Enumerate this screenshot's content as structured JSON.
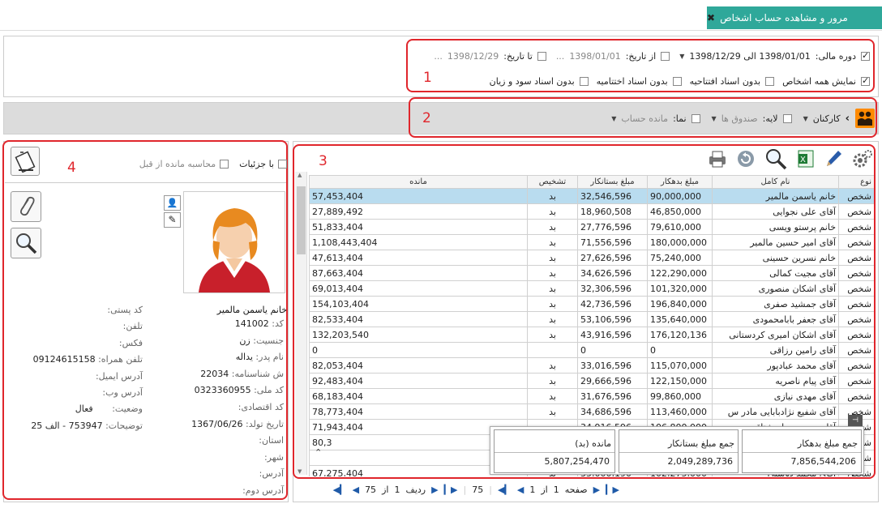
{
  "title_bar": {
    "title": "مرور و مشاهده حساب اشخاص",
    "close_icon": "✖"
  },
  "filters": {
    "fiscal_period_label": "دوره مالی:",
    "fiscal_period_value": "1398/01/01 الی 1398/12/29",
    "from_date_label": "از تاریخ:",
    "from_date_value": "1398/01/01",
    "to_date_label": "تا تاریخ:",
    "to_date_value": "1398/12/29",
    "ellipsis": "...",
    "show_all_persons": "نمایش همه اشخاص",
    "no_opening_docs": "بدون اسناد افتتاحیه",
    "no_closing_docs": "بدون اسناد اختتامیه",
    "no_profit_loss_docs": "بدون اسناد سود و زیان"
  },
  "toolbar": {
    "group_value": "کارکنان",
    "layer_label": "لایه:",
    "layer_value": "صندوق ها",
    "view_label": "نما:",
    "view_value": "مانده حساب"
  },
  "grid": {
    "headers": [
      "نوع",
      "نام کامل",
      "مبلغ بدهکار",
      "مبلغ بستانکار",
      "تشخیص",
      "مانده"
    ],
    "rows": [
      [
        "شخص",
        "خانم یاسمن مالمیر",
        "90,000,000",
        "32,546,596",
        "بد",
        "57,453,404"
      ],
      [
        "شخص",
        "آقای علی نجوایی",
        "46,850,000",
        "18,960,508",
        "بد",
        "27,889,492"
      ],
      [
        "شخص",
        "خانم پرستو ویسی",
        "79,610,000",
        "27,776,596",
        "بد",
        "51,833,404"
      ],
      [
        "شخص",
        "آقای امیر حسین مالمیر",
        "180,000,000",
        "71,556,596",
        "بد",
        "1,108,443,404"
      ],
      [
        "شخص",
        "خانم نسرین حسینی",
        "75,240,000",
        "27,626,596",
        "بد",
        "47,613,404"
      ],
      [
        "شخص",
        "آقای مجیت کمالی",
        "122,290,000",
        "34,626,596",
        "بد",
        "87,663,404"
      ],
      [
        "شخص",
        "آقای اشکان منصوری",
        "101,320,000",
        "32,306,596",
        "بد",
        "69,013,404"
      ],
      [
        "شخص",
        "آقای جمشید صفری",
        "196,840,000",
        "42,736,596",
        "بد",
        "154,103,404"
      ],
      [
        "شخص",
        "آقای جعفر بابامحمودی",
        "135,640,000",
        "53,106,596",
        "بد",
        "82,533,404"
      ],
      [
        "شخص",
        "آقای اشکان امیری کردستانی",
        "176,120,136",
        "43,916,596",
        "بد",
        "132,203,540"
      ],
      [
        "شخص",
        "آقای رامین رزاقی",
        "0",
        "0",
        "",
        "0"
      ],
      [
        "شخص",
        "آقای محمد عبادپور",
        "115,070,000",
        "33,016,596",
        "بد",
        "82,053,404"
      ],
      [
        "شخص",
        "آقای پیام ناصریه",
        "122,150,000",
        "29,666,596",
        "بد",
        "92,483,404"
      ],
      [
        "شخص",
        "آقای مهدی نیازی",
        "99,860,000",
        "31,676,596",
        "بد",
        "68,183,404"
      ],
      [
        "شخص",
        "آقای شفیع نژادبابایی مادر س",
        "113,460,000",
        "34,686,596",
        "بد",
        "78,773,404"
      ],
      [
        "شخص",
        "آقای محمدرضا مشتاقی",
        "106,800,000",
        "34,916,596",
        "بد",
        "71,943,404"
      ],
      [
        "شخص",
        "",
        "",
        "",
        "",
        "80,3"
      ],
      [
        "شخص",
        "",
        "",
        "",
        "",
        ""
      ],
      [
        "شخص",
        "آقای محمد دوستی",
        "102,275,000",
        "35,000,190",
        "بد",
        "67,275,404"
      ]
    ],
    "totals": {
      "debit_label": "جمع مبلغ بدهکار",
      "debit_value": "7,856,544,206",
      "credit_label": "جمع مبلغ بستانکار",
      "credit_value": "2,049,289,736",
      "balance_label": "مانده (بد)",
      "balance_value": "5,807,254,470"
    },
    "pager": {
      "page_label": "صفحه",
      "page_value": "1",
      "of_label": "از",
      "page_total": "1",
      "rows_label": "ردیف",
      "row_value": "1",
      "row_of_label": "از",
      "row_total": "75",
      "count": "75"
    }
  },
  "details": {
    "with_details": "با جزئیات",
    "calc_prev_balance": "محاسبه مانده از قبل",
    "name": "خانم یاسمن مالمیر",
    "labels": {
      "code": "کد:",
      "gender": "جنسیت:",
      "father": "نام پدر:",
      "id_no": "ش شناسنامه:",
      "national_code": "کد ملی:",
      "economic_code": "کد اقتصادی:",
      "birth_date": "تاریخ تولد:",
      "province": "استان:",
      "city": "شهر:",
      "address": "آدرس:",
      "address2": "آدرس دوم:",
      "postal": "کد پستی:",
      "phone": "تلفن:",
      "fax": "فکس:",
      "mobile": "تلفن همراه:",
      "email": "آدرس ایمیل:",
      "web": "آدرس وب:",
      "status": "وضعیت:",
      "notes": "توضیحات:"
    },
    "values": {
      "code": "141002",
      "gender": "زن",
      "father": "یداله",
      "id_no": "22034",
      "national_code": "0323360955",
      "birth_date": "1367/06/26",
      "mobile": "09124615158",
      "status": "فعال",
      "notes": "753947 - الف 25"
    }
  },
  "annotations": {
    "a1": "1",
    "a2": "2",
    "a3": "3",
    "a4": "4"
  },
  "colors": {
    "title_bg": "#2fa89a",
    "annotation": "#e0262c",
    "selected_row": "#b9dcef"
  }
}
